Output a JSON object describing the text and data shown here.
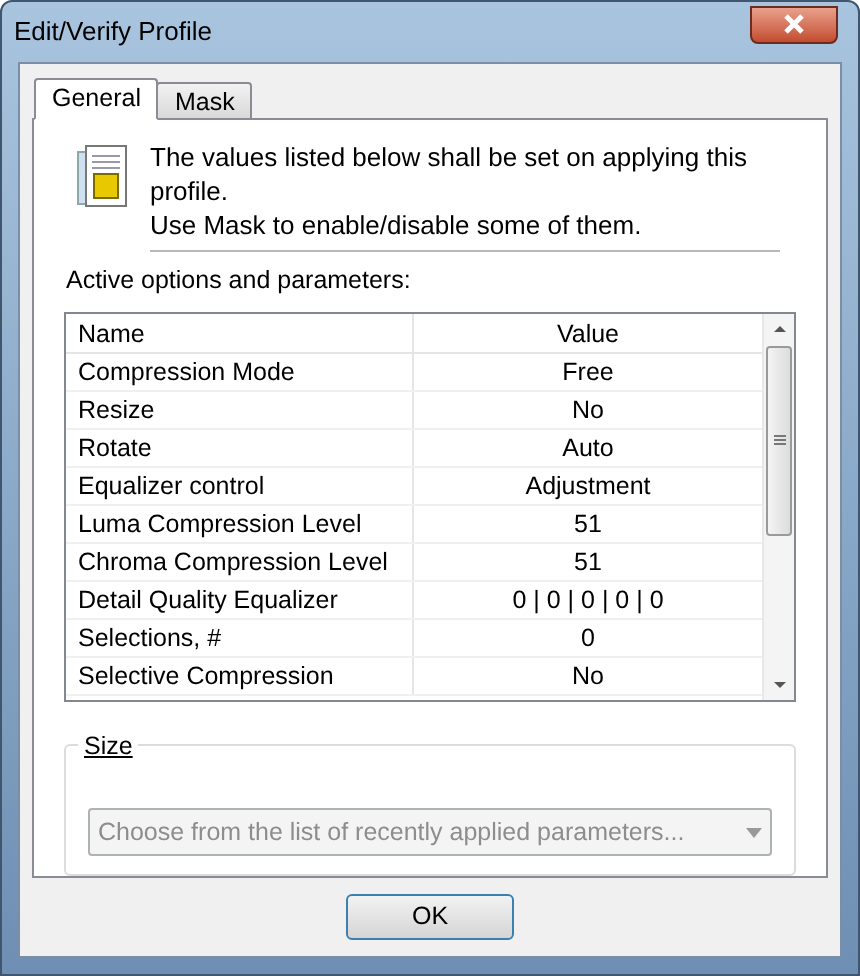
{
  "window": {
    "title": "Edit/Verify Profile"
  },
  "tabs": [
    {
      "label": "General",
      "selected": true
    },
    {
      "label": "Mask",
      "selected": false
    }
  ],
  "info": {
    "line1": "The values listed below shall be set on applying this profile.",
    "line2": "Use Mask to enable/disable some of them."
  },
  "section_label": "Active options and parameters:",
  "table": {
    "columns": [
      "Name",
      "Value"
    ],
    "rows": [
      {
        "name": "Compression Mode",
        "value": "Free"
      },
      {
        "name": "Resize",
        "value": "No"
      },
      {
        "name": "Rotate",
        "value": "Auto"
      },
      {
        "name": "Equalizer control",
        "value": "Adjustment"
      },
      {
        "name": "Luma Compression Level",
        "value": "51"
      },
      {
        "name": "Chroma Compression Level",
        "value": "51"
      },
      {
        "name": "Detail Quality Equalizer",
        "value": "0 | 0 | 0 | 0 | 0"
      },
      {
        "name": "Selections, #",
        "value": "0"
      },
      {
        "name": "Selective Compression",
        "value": "No"
      }
    ]
  },
  "size_group": {
    "label": "Size",
    "combo": {
      "placeholder": "Choose from the list of recently applied parameters...",
      "disabled": true
    }
  },
  "buttons": [
    {
      "label": "OK"
    }
  ]
}
